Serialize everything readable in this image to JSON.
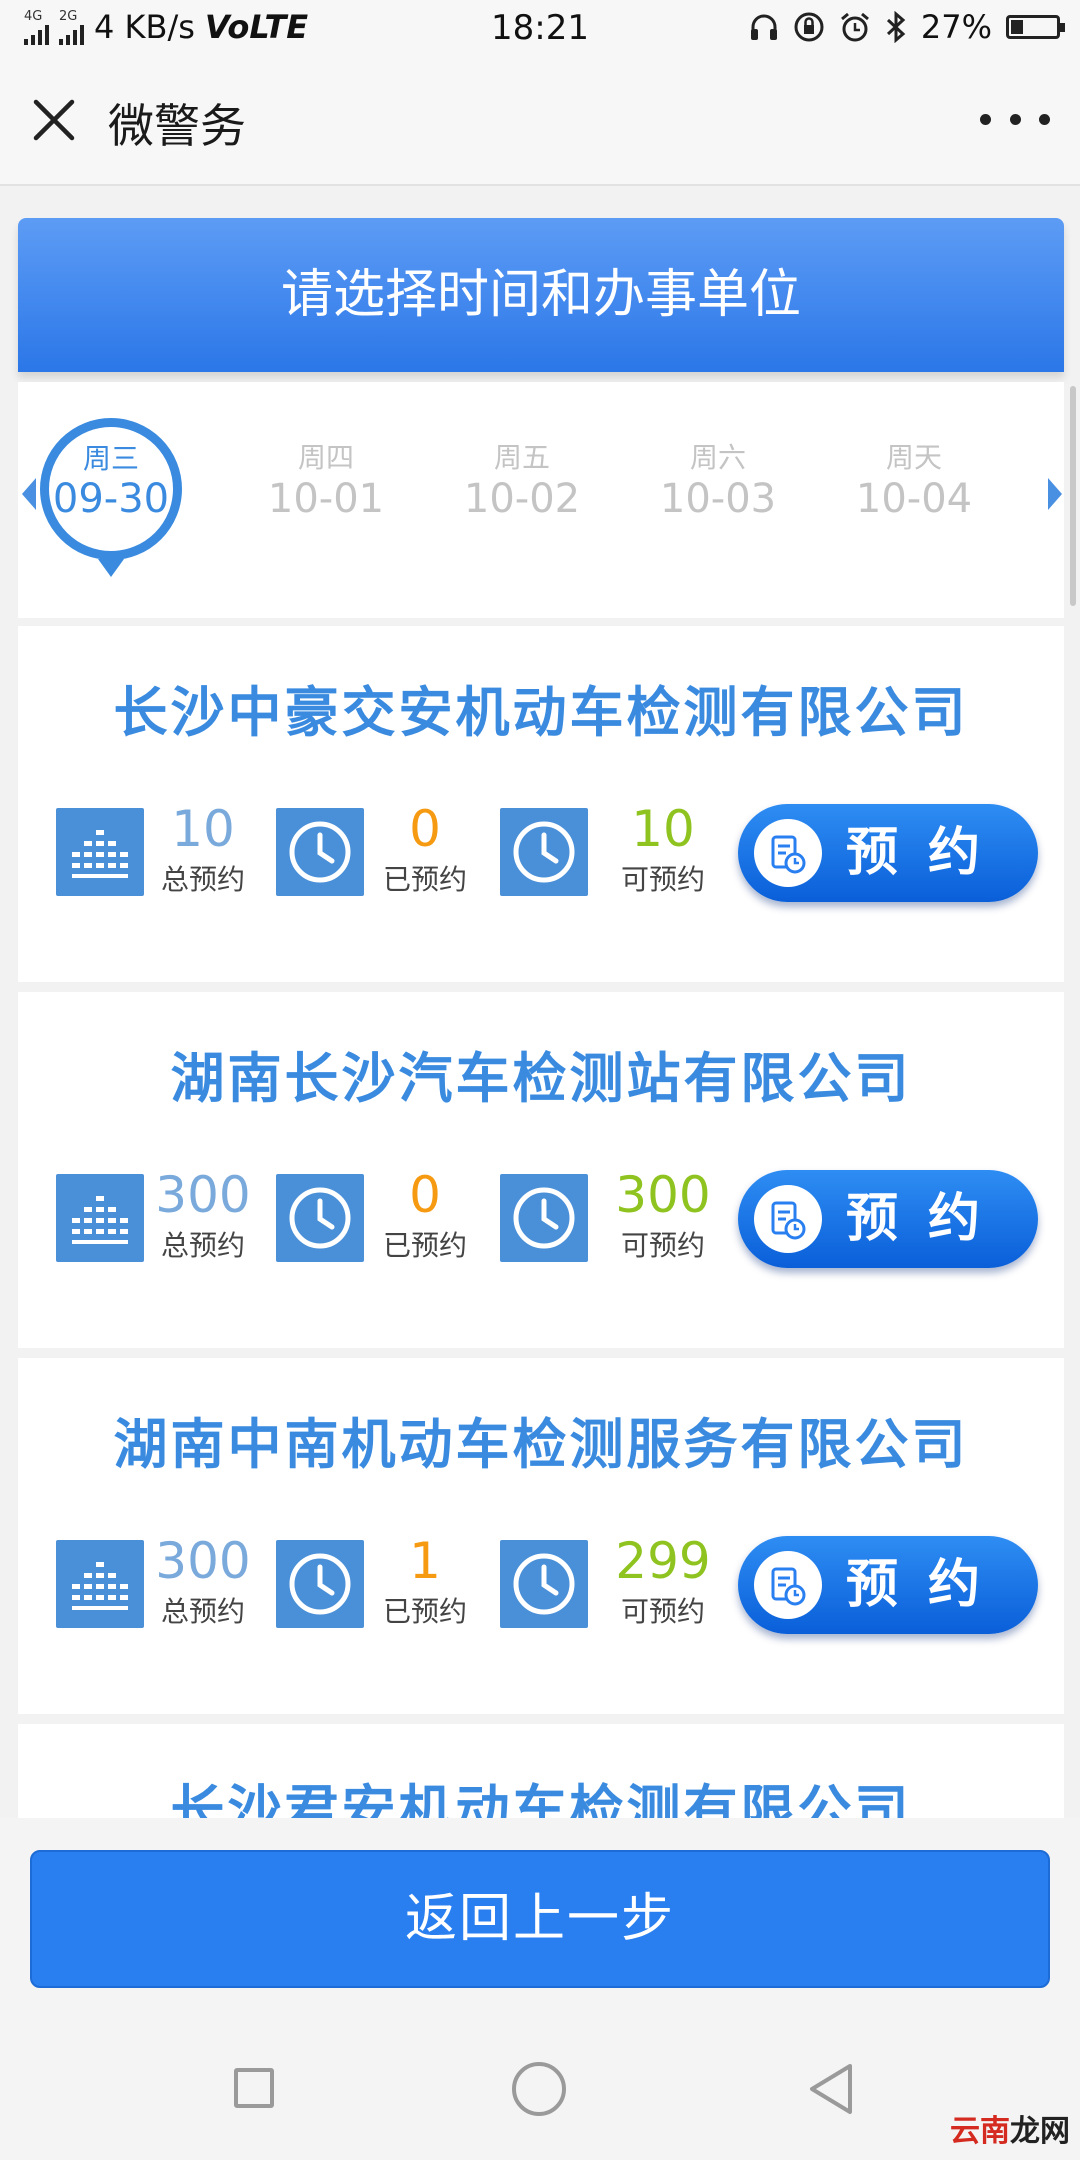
{
  "status_bar": {
    "net_top": "4G",
    "net_bottom": "2G",
    "speed": "4 KB/s",
    "volte": "VoLTE",
    "time": "18:21",
    "battery": "27%",
    "battery_level": 0.27
  },
  "header": {
    "title": "微警务"
  },
  "banner": {
    "title": "请选择时间和办事单位"
  },
  "dates": [
    {
      "weekday": "周三",
      "date": "09-30",
      "selected": true
    },
    {
      "weekday": "周四",
      "date": "10-01"
    },
    {
      "weekday": "周五",
      "date": "10-02"
    },
    {
      "weekday": "周六",
      "date": "10-03"
    },
    {
      "weekday": "周天",
      "date": "10-04"
    }
  ],
  "labels": {
    "total": "总预约",
    "booked": "已预约",
    "available": "可预约",
    "book_button": "预约"
  },
  "colors": {
    "total": "#7aa9db",
    "booked": "#f59a11",
    "available": "#8fc31f",
    "accent": "#3a8be0"
  },
  "stations": [
    {
      "name": "长沙中豪交安机动车检测有限公司",
      "total": "10",
      "booked": "0",
      "available": "10"
    },
    {
      "name": "湖南长沙汽车检测站有限公司",
      "total": "300",
      "booked": "0",
      "available": "300"
    },
    {
      "name": "湖南中南机动车检测服务有限公司",
      "total": "300",
      "booked": "1",
      "available": "299"
    },
    {
      "name": "长沙君安机动车检测有限公司"
    }
  ],
  "footer": {
    "back_button": "返回上一步"
  },
  "watermark": {
    "part1": "云南",
    "part2": "龙网"
  }
}
